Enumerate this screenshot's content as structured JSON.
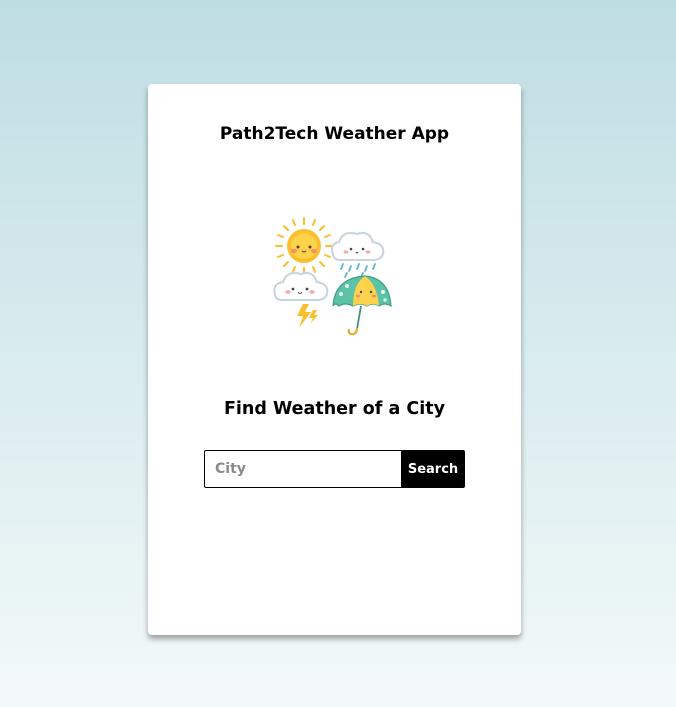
{
  "header": {
    "title": "Path2Tech Weather App"
  },
  "illustration": {
    "icon": "weather-icons"
  },
  "main": {
    "subtitle": "Find Weather of a City"
  },
  "search": {
    "placeholder": "City",
    "value": "",
    "button_label": "Search"
  },
  "colors": {
    "button_bg": "#000000",
    "button_text": "#ffffff",
    "sun": "#f9c02c",
    "umbrella": "#5cc2a8"
  }
}
